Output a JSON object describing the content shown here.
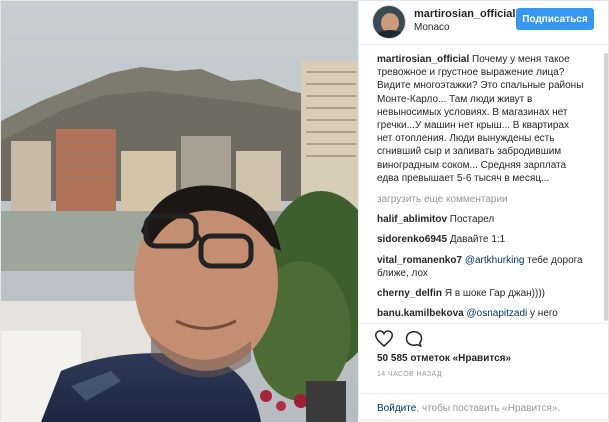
{
  "header": {
    "username": "martirosian_official",
    "location": "Monaco",
    "follow_label": "Подписаться"
  },
  "caption": {
    "username": "martirosian_official",
    "text": "Почему у меня такое тревожное и грустное выражение лица? Видите многоэтажки? Это спальные районы Монте-Карло... Там люди живут в невыносимых условиях. В магазинах нет гречки...У машин нет крыш... В квартирах нет отопления. Люди вынуждены есть сгнивший сыр и запивать забродившим виноградным соком... Средняя зарплата едва превышает 5-6 тысяч в месяц..."
  },
  "load_more": "загрузить еще комментарии",
  "comments": [
    {
      "username": "halif_ablimitov",
      "text": "Постарел",
      "mention": ""
    },
    {
      "username": "sidorenko6945",
      "text": "Давайте 1:1",
      "mention": ""
    },
    {
      "username": "vital_romanenko7",
      "mention": "@artkhurking",
      "text": "тебе дорога ближе, лох"
    },
    {
      "username": "cherny_delfin",
      "text": "Я в шоке Гар джан))))",
      "mention": ""
    },
    {
      "username": "banu.kamilbekova",
      "mention": "@osnapitzadi",
      "text": "у него"
    }
  ],
  "actions": {
    "like_icon": "heart-outline-icon",
    "comment_icon": "speech-bubble-icon"
  },
  "likes": "50 585 отметок «Нравится»",
  "timestamp": "14 ЧАСОВ НАЗАД",
  "add_comment": {
    "login": "Войдите",
    "rest": ", чтобы поставить «Нравится»."
  },
  "colors": {
    "accent": "#3897f0",
    "link": "#003569",
    "muted": "#999999"
  }
}
